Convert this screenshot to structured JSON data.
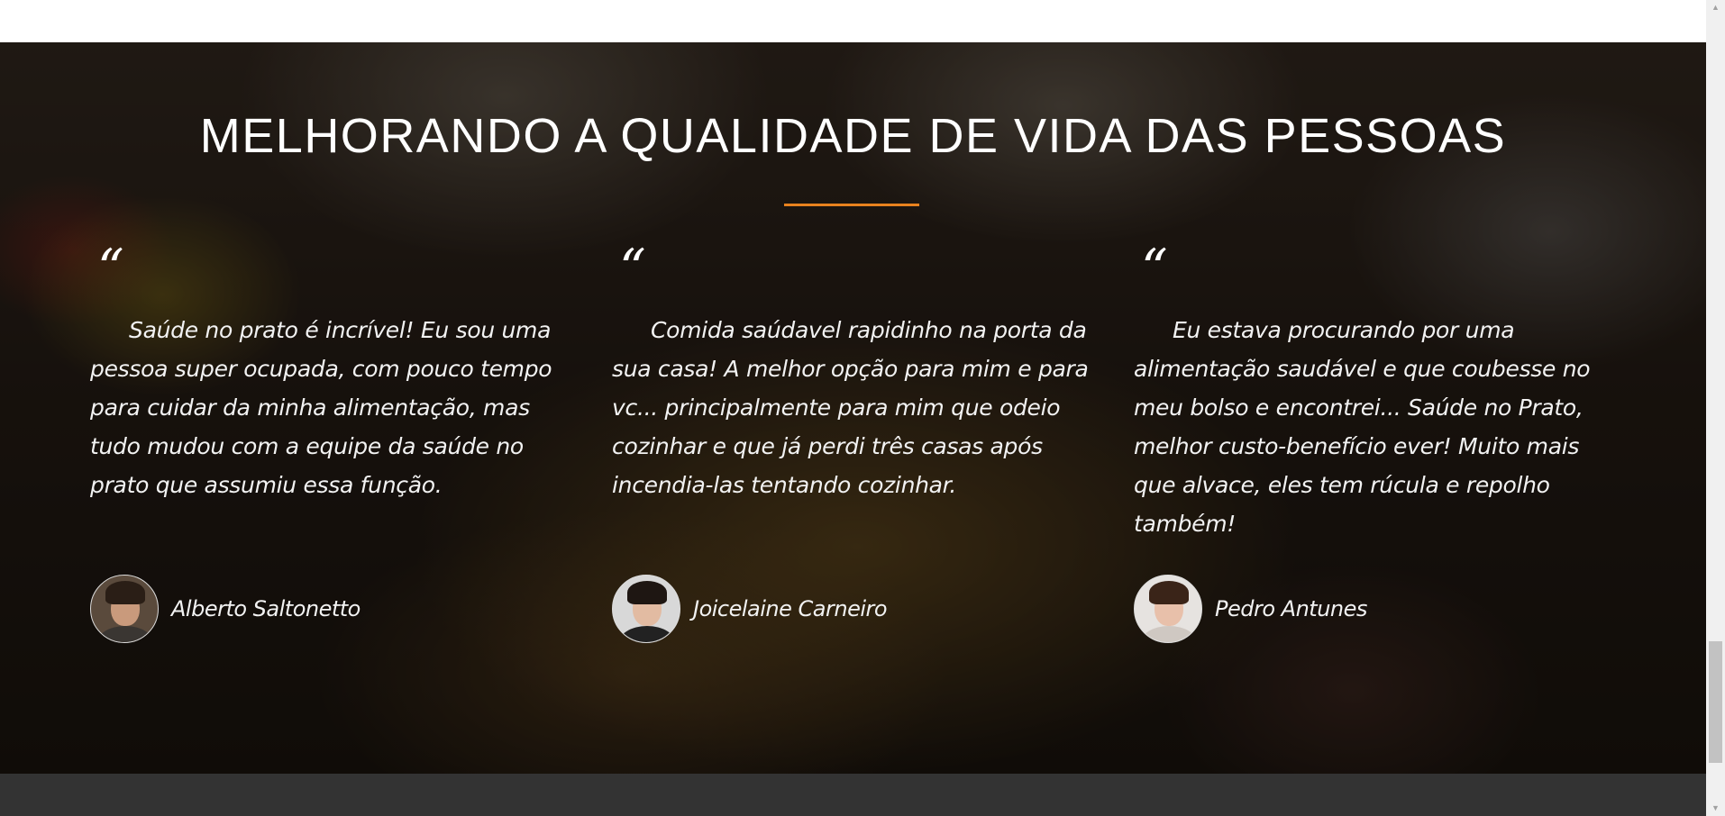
{
  "section": {
    "title": "MELHORANDO A QUALIDADE DE VIDA DAS PESSOAS",
    "accent_color": "#e8821e"
  },
  "testimonials": [
    {
      "quote_mark": "“",
      "text": "Saúde no prato é incrível! Eu sou uma pessoa super ocupada, com pouco tempo para cuidar da minha alimentação, mas tudo mudou com a equipe da saúde no prato que assumiu essa função.",
      "author": "Alberto Saltonetto"
    },
    {
      "quote_mark": "“",
      "text": "Comida saúdavel rapidinho na porta da sua casa! A melhor opção para mim e para vc... principalmente para mim que odeio cozinhar e que já perdi três casas após incendia-las tentando cozinhar.",
      "author": "Joicelaine Carneiro"
    },
    {
      "quote_mark": "“",
      "text": "Eu estava procurando por uma alimentação saudável e que coubesse no meu bolso e encontrei... Saúde no Prato, melhor custo-benefício ever! Muito mais que alvace, eles tem rúcula e repolho também!",
      "author": "Pedro Antunes"
    }
  ],
  "scrollbar": {
    "up_icon": "▲",
    "down_icon": "▼"
  }
}
